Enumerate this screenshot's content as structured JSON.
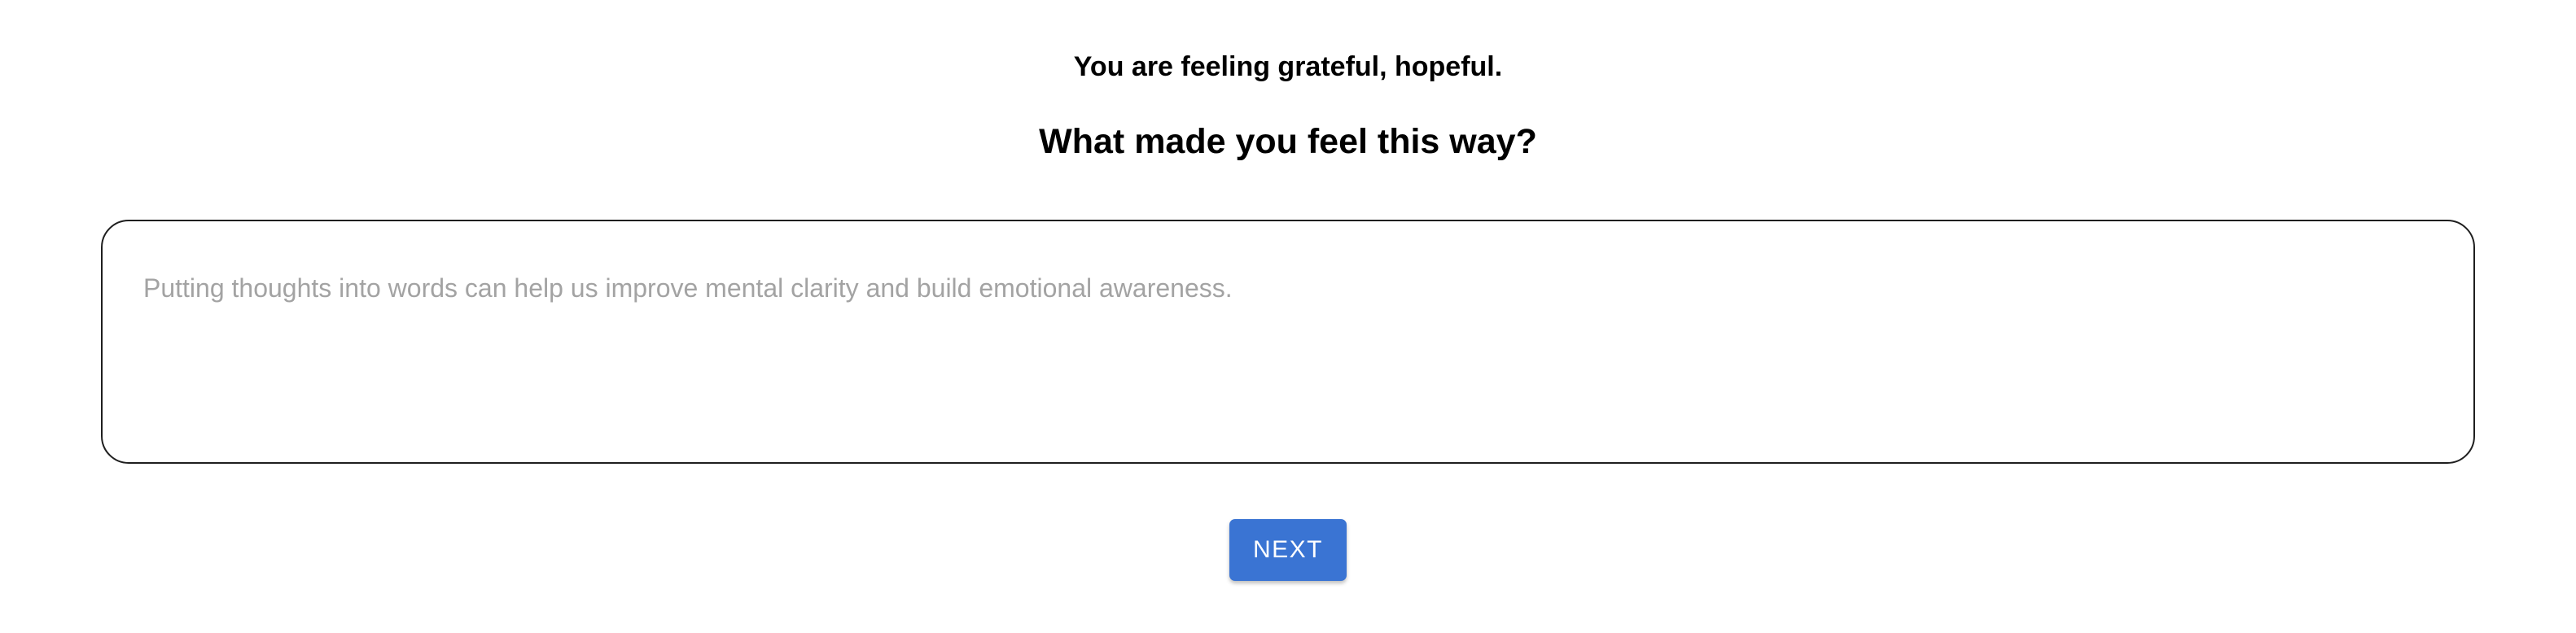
{
  "header": {
    "feeling_text": "You are feeling grateful, hopeful.",
    "question": "What made you feel this way?"
  },
  "entry": {
    "value": "",
    "placeholder": "Putting thoughts into words can help us improve mental clarity and build emotional awareness."
  },
  "actions": {
    "next_label": "NEXT"
  },
  "colors": {
    "accent": "#3a74d3",
    "placeholder": "#a3a3a3",
    "border": "#1f1f1f"
  }
}
